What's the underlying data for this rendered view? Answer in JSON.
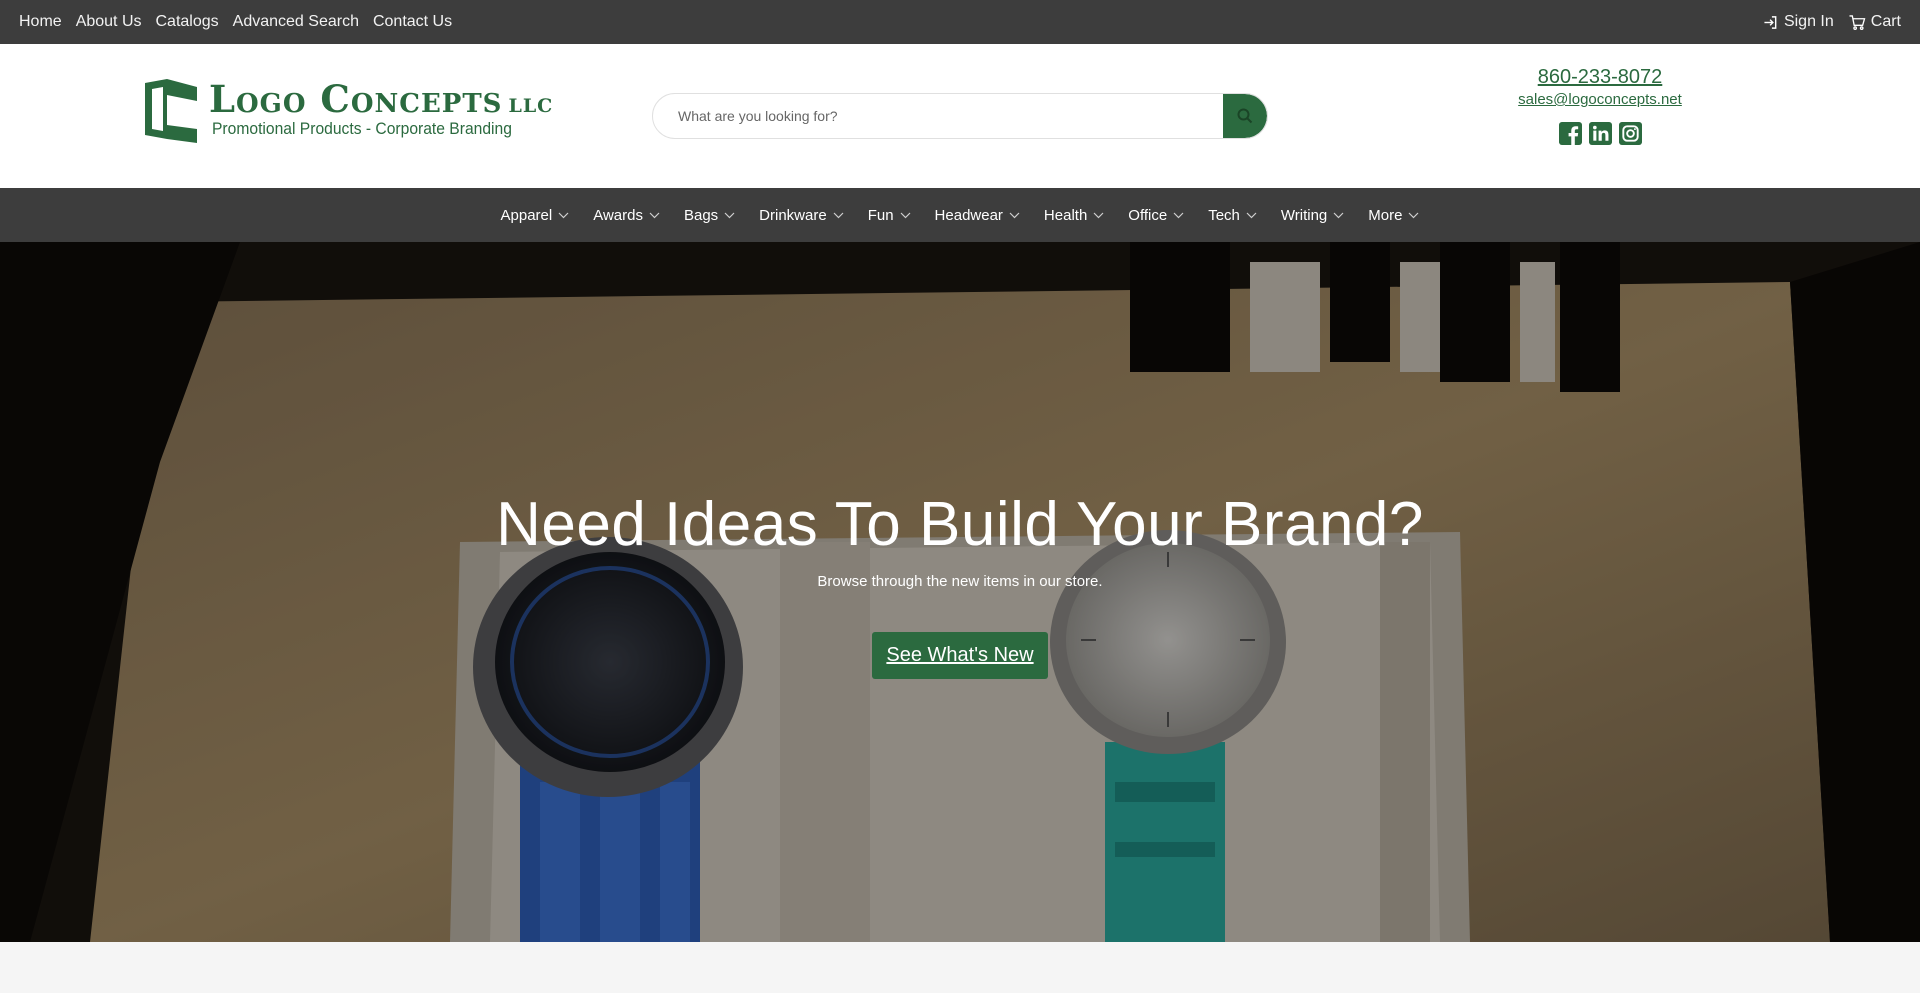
{
  "topbar": {
    "links": [
      "Home",
      "About Us",
      "Catalogs",
      "Advanced Search",
      "Contact Us"
    ],
    "sign_in": "Sign In",
    "cart": "Cart"
  },
  "logo": {
    "brand": "Logo Concepts",
    "llc": "LLC",
    "tagline": "Promotional Products - Corporate Branding"
  },
  "search": {
    "placeholder": "What are you looking for?"
  },
  "contact": {
    "phone": "860-233-8072",
    "email": "sales@logoconcepts.net",
    "social": [
      "facebook-icon",
      "linkedin-icon",
      "instagram-icon"
    ]
  },
  "categories": [
    "Apparel",
    "Awards",
    "Bags",
    "Drinkware",
    "Fun",
    "Headwear",
    "Health",
    "Office",
    "Tech",
    "Writing",
    "More"
  ],
  "hero": {
    "title": "Need Ideas To Build Your Brand?",
    "subtitle": "Browse through the new items in our store.",
    "cta": "See What's New"
  },
  "colors": {
    "brand_green": "#2b6a3f",
    "bar_dark": "#3d3d3d"
  }
}
